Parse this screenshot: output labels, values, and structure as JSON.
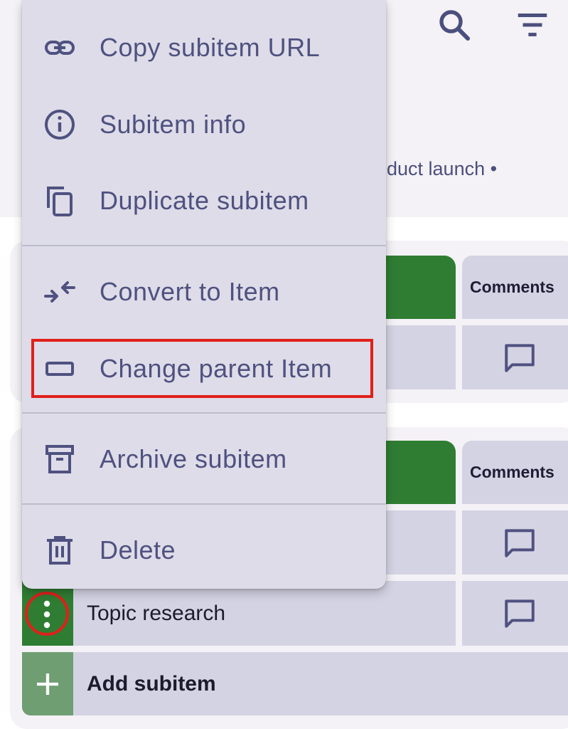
{
  "header": {
    "breadcrumb": "roduct launch •",
    "search_icon": "search-icon",
    "filter_icon": "filter-icon"
  },
  "groups": [
    {
      "comments_header": "Comments"
    },
    {
      "comments_header": "Comments"
    }
  ],
  "rows": [
    {
      "name": "Topic research"
    }
  ],
  "add_subitem_label": "Add subitem",
  "menu": {
    "items": [
      {
        "label": "Copy subitem URL",
        "icon": "link-icon"
      },
      {
        "label": "Subitem info",
        "icon": "info-icon"
      },
      {
        "label": "Duplicate subitem",
        "icon": "copy-icon"
      },
      {
        "label": "Convert to Item",
        "icon": "convert-icon"
      },
      {
        "label": "Change parent Item",
        "icon": "parent-item-icon"
      },
      {
        "label": "Archive subitem",
        "icon": "archive-icon"
      },
      {
        "label": "Delete",
        "icon": "trash-icon"
      }
    ]
  },
  "colors": {
    "green": "#2f7d32",
    "menu_bg": "#dddce8",
    "menu_text": "#4f5180",
    "highlight": "#e0201b"
  }
}
